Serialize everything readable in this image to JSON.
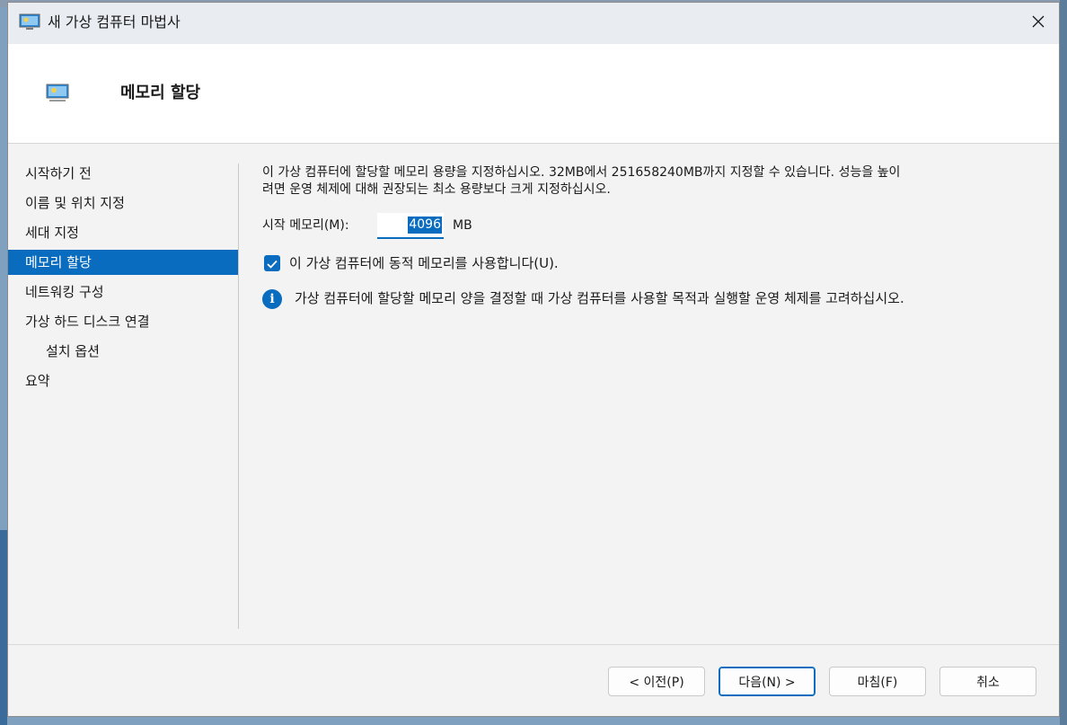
{
  "window": {
    "title": "새 가상 컴퓨터 마법사"
  },
  "header": {
    "title": "메모리 할당"
  },
  "sidebar": {
    "items": [
      {
        "label": "시작하기 전"
      },
      {
        "label": "이름 및 위치 지정"
      },
      {
        "label": "세대 지정"
      },
      {
        "label": "메모리 할당",
        "active": true
      },
      {
        "label": "네트워킹 구성"
      },
      {
        "label": "가상 하드 디스크 연결"
      },
      {
        "label": "설치 옵션"
      },
      {
        "label": "요약"
      }
    ]
  },
  "content": {
    "description_line1": "이 가상 컴퓨터에 할당할 메모리 용량을 지정하십시오. 32MB에서 251658240MB까지 지정할 수 있습니다. 성능을 높이",
    "description_line2": "려면 운영 체제에 대해 권장되는 최소 용량보다 크게 지정하십시오.",
    "startup_memory_label": "시작 메모리(M):",
    "startup_memory_value": "4096",
    "startup_memory_unit": "MB",
    "dynamic_memory_label": "이 가상 컴퓨터에 동적 메모리를 사용합니다(U).",
    "dynamic_memory_checked": true,
    "info_text": "가상 컴퓨터에 할당할 메모리 양을 결정할 때 가상 컴퓨터를 사용할 목적과 실행할 운영 체제를 고려하십시오."
  },
  "buttons": {
    "previous": "< 이전(P)",
    "next": "다음(N) >",
    "finish": "마침(F)",
    "cancel": "취소"
  },
  "colors": {
    "accent": "#0a6cbf",
    "titlebar": "#e9edf2",
    "window_bg": "#f3f3f3"
  },
  "icons": {
    "title": "hyper-v-monitor-icon",
    "header": "hyper-v-monitor-icon",
    "close": "close-icon",
    "info": "info-icon",
    "check": "checkmark-icon"
  }
}
